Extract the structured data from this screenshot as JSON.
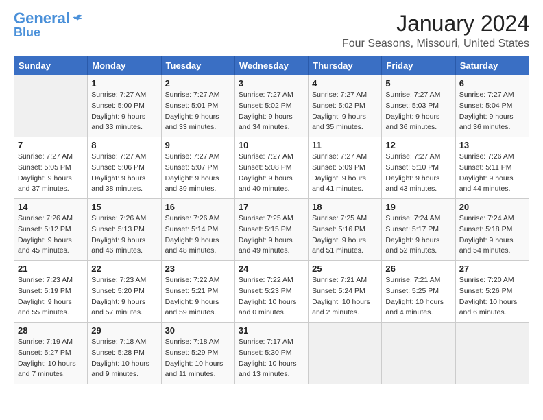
{
  "header": {
    "logo_general": "General",
    "logo_blue": "Blue",
    "month_title": "January 2024",
    "location": "Four Seasons, Missouri, United States"
  },
  "days_of_week": [
    "Sunday",
    "Monday",
    "Tuesday",
    "Wednesday",
    "Thursday",
    "Friday",
    "Saturday"
  ],
  "weeks": [
    [
      {
        "day": "",
        "empty": true
      },
      {
        "day": "1",
        "sunrise": "7:27 AM",
        "sunset": "5:00 PM",
        "daylight": "9 hours and 33 minutes."
      },
      {
        "day": "2",
        "sunrise": "7:27 AM",
        "sunset": "5:01 PM",
        "daylight": "9 hours and 33 minutes."
      },
      {
        "day": "3",
        "sunrise": "7:27 AM",
        "sunset": "5:02 PM",
        "daylight": "9 hours and 34 minutes."
      },
      {
        "day": "4",
        "sunrise": "7:27 AM",
        "sunset": "5:02 PM",
        "daylight": "9 hours and 35 minutes."
      },
      {
        "day": "5",
        "sunrise": "7:27 AM",
        "sunset": "5:03 PM",
        "daylight": "9 hours and 36 minutes."
      },
      {
        "day": "6",
        "sunrise": "7:27 AM",
        "sunset": "5:04 PM",
        "daylight": "9 hours and 36 minutes."
      }
    ],
    [
      {
        "day": "7",
        "sunrise": "7:27 AM",
        "sunset": "5:05 PM",
        "daylight": "9 hours and 37 minutes."
      },
      {
        "day": "8",
        "sunrise": "7:27 AM",
        "sunset": "5:06 PM",
        "daylight": "9 hours and 38 minutes."
      },
      {
        "day": "9",
        "sunrise": "7:27 AM",
        "sunset": "5:07 PM",
        "daylight": "9 hours and 39 minutes."
      },
      {
        "day": "10",
        "sunrise": "7:27 AM",
        "sunset": "5:08 PM",
        "daylight": "9 hours and 40 minutes."
      },
      {
        "day": "11",
        "sunrise": "7:27 AM",
        "sunset": "5:09 PM",
        "daylight": "9 hours and 41 minutes."
      },
      {
        "day": "12",
        "sunrise": "7:27 AM",
        "sunset": "5:10 PM",
        "daylight": "9 hours and 43 minutes."
      },
      {
        "day": "13",
        "sunrise": "7:26 AM",
        "sunset": "5:11 PM",
        "daylight": "9 hours and 44 minutes."
      }
    ],
    [
      {
        "day": "14",
        "sunrise": "7:26 AM",
        "sunset": "5:12 PM",
        "daylight": "9 hours and 45 minutes."
      },
      {
        "day": "15",
        "sunrise": "7:26 AM",
        "sunset": "5:13 PM",
        "daylight": "9 hours and 46 minutes."
      },
      {
        "day": "16",
        "sunrise": "7:26 AM",
        "sunset": "5:14 PM",
        "daylight": "9 hours and 48 minutes."
      },
      {
        "day": "17",
        "sunrise": "7:25 AM",
        "sunset": "5:15 PM",
        "daylight": "9 hours and 49 minutes."
      },
      {
        "day": "18",
        "sunrise": "7:25 AM",
        "sunset": "5:16 PM",
        "daylight": "9 hours and 51 minutes."
      },
      {
        "day": "19",
        "sunrise": "7:24 AM",
        "sunset": "5:17 PM",
        "daylight": "9 hours and 52 minutes."
      },
      {
        "day": "20",
        "sunrise": "7:24 AM",
        "sunset": "5:18 PM",
        "daylight": "9 hours and 54 minutes."
      }
    ],
    [
      {
        "day": "21",
        "sunrise": "7:23 AM",
        "sunset": "5:19 PM",
        "daylight": "9 hours and 55 minutes."
      },
      {
        "day": "22",
        "sunrise": "7:23 AM",
        "sunset": "5:20 PM",
        "daylight": "9 hours and 57 minutes."
      },
      {
        "day": "23",
        "sunrise": "7:22 AM",
        "sunset": "5:21 PM",
        "daylight": "9 hours and 59 minutes."
      },
      {
        "day": "24",
        "sunrise": "7:22 AM",
        "sunset": "5:23 PM",
        "daylight": "10 hours and 0 minutes."
      },
      {
        "day": "25",
        "sunrise": "7:21 AM",
        "sunset": "5:24 PM",
        "daylight": "10 hours and 2 minutes."
      },
      {
        "day": "26",
        "sunrise": "7:21 AM",
        "sunset": "5:25 PM",
        "daylight": "10 hours and 4 minutes."
      },
      {
        "day": "27",
        "sunrise": "7:20 AM",
        "sunset": "5:26 PM",
        "daylight": "10 hours and 6 minutes."
      }
    ],
    [
      {
        "day": "28",
        "sunrise": "7:19 AM",
        "sunset": "5:27 PM",
        "daylight": "10 hours and 7 minutes."
      },
      {
        "day": "29",
        "sunrise": "7:18 AM",
        "sunset": "5:28 PM",
        "daylight": "10 hours and 9 minutes."
      },
      {
        "day": "30",
        "sunrise": "7:18 AM",
        "sunset": "5:29 PM",
        "daylight": "10 hours and 11 minutes."
      },
      {
        "day": "31",
        "sunrise": "7:17 AM",
        "sunset": "5:30 PM",
        "daylight": "10 hours and 13 minutes."
      },
      {
        "day": "",
        "empty": true
      },
      {
        "day": "",
        "empty": true
      },
      {
        "day": "",
        "empty": true
      }
    ]
  ]
}
